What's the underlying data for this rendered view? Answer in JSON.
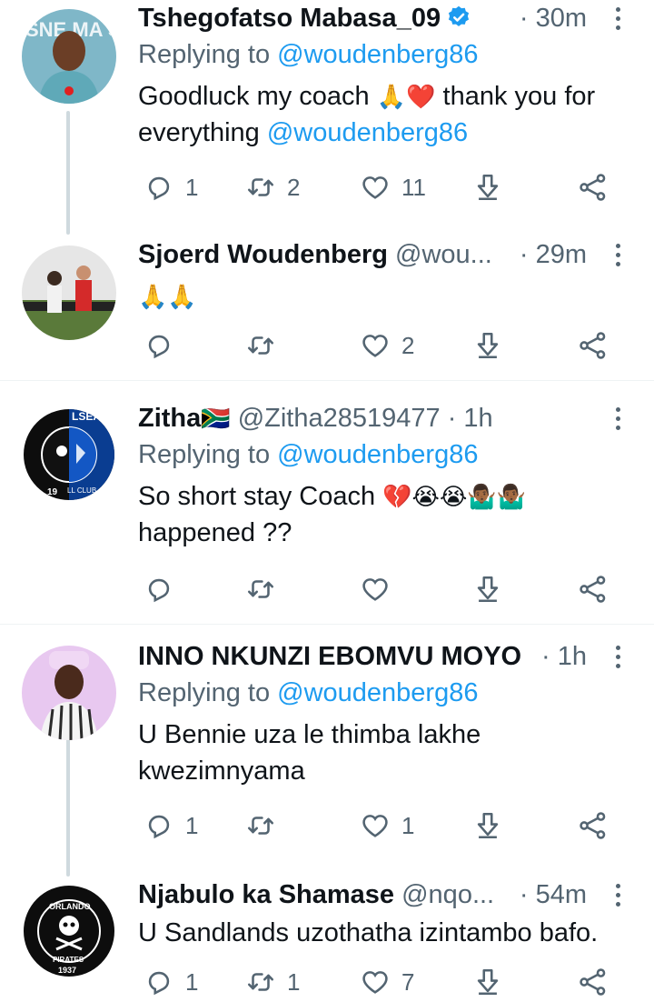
{
  "tweets": [
    {
      "name": "Tshegofatso Mabasa_09",
      "handle": "",
      "verified": true,
      "time": "· 30m",
      "reply_prefix": "Replying to ",
      "reply_to": "@woudenberg86",
      "text_parts": [
        "Goodluck my coach ",
        "🙏❤️",
        " thank you for everything ",
        "@woudenberg86"
      ],
      "replies": "1",
      "retweets": "2",
      "likes": "11",
      "avatar_text": "SNE MA SA"
    },
    {
      "name": "Sjoerd Woudenberg",
      "handle": " @wou...",
      "verified": false,
      "time": "· 29m",
      "text": "🙏🙏",
      "replies": "",
      "retweets": "",
      "likes": "2"
    },
    {
      "name": "Zitha",
      "name_emoji": "🇿🇦",
      "handle": " @Zitha28519477 · 1h",
      "time": "",
      "reply_prefix": "Replying to ",
      "reply_to": "@woudenberg86",
      "text_parts": [
        "So short stay Coach ",
        "💔😭😭🤷🏾‍♂️🤷🏾‍♂️",
        " happened ??"
      ],
      "replies": "",
      "retweets": "",
      "likes": "",
      "avatar_text": [
        "LSEA",
        "19",
        "LL CLUB"
      ]
    },
    {
      "name": "INNO NKUNZI EBOMVU MOYO",
      "handle": "",
      "time": "· 1h",
      "reply_prefix": "Replying to ",
      "reply_to": "@woudenberg86",
      "text": "U Bennie uza le thimba lakhe kwezimnyama",
      "replies": "1",
      "retweets": "",
      "likes": "1"
    },
    {
      "name": "Njabulo ka Shamase",
      "handle": " @nqo...",
      "time": "· 54m",
      "text": "U Sandlands uzothatha izintambo bafo.",
      "replies": "1",
      "retweets": "1",
      "likes": "7",
      "avatar_text": [
        "ORLANDO",
        "PIRATES",
        "1937"
      ]
    }
  ],
  "colors": {
    "text": "#0f1419",
    "secondary": "#536471",
    "link": "#1d9bf0",
    "divider": "#eff3f4",
    "thread_line": "#cfd9de"
  },
  "icons": [
    "reply-icon",
    "retweet-icon",
    "like-icon",
    "upload-icon",
    "share-icon",
    "more-icon",
    "verified-badge-icon"
  ]
}
